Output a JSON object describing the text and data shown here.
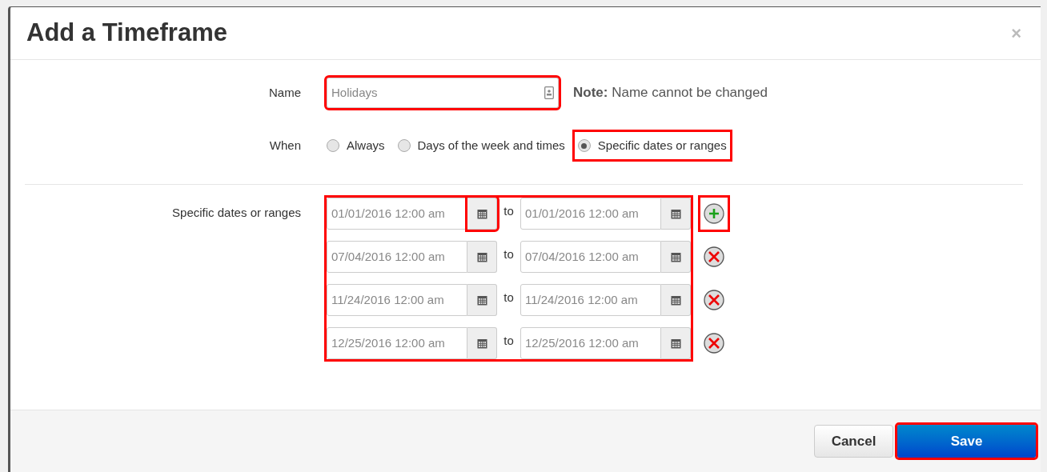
{
  "dialog": {
    "title": "Add a Timeframe",
    "close": "×"
  },
  "name_field": {
    "label": "Name",
    "value": "Holidays",
    "highlighted": true,
    "note_bold": "Note:",
    "note": "Name cannot be changed"
  },
  "when": {
    "label": "When",
    "options": [
      {
        "label": "Always",
        "selected": false,
        "highlighted": false
      },
      {
        "label": "Days of the week and times",
        "selected": false,
        "highlighted": false
      },
      {
        "label": "Specific dates or ranges",
        "selected": true,
        "highlighted": true
      }
    ]
  },
  "ranges": {
    "label": "Specific dates or ranges",
    "highlighted": true,
    "rows": [
      {
        "from": "01/01/2016 12:00 am",
        "separator": "to",
        "to": "01/01/2016 12:00 am",
        "kind": "add",
        "from_button_highlighted": true,
        "action_highlighted": true
      },
      {
        "from": "07/04/2016 12:00 am",
        "separator": "to",
        "to": "07/04/2016 12:00 am",
        "kind": "remove",
        "from_button_highlighted": false,
        "action_highlighted": false
      },
      {
        "from": "11/24/2016 12:00 am",
        "separator": "to",
        "to": "11/24/2016 12:00 am",
        "kind": "remove",
        "from_button_highlighted": false,
        "action_highlighted": false
      },
      {
        "from": "12/25/2016 12:00 am",
        "separator": "to",
        "to": "12/25/2016 12:00 am",
        "kind": "remove",
        "from_button_highlighted": false,
        "action_highlighted": false
      }
    ]
  },
  "footer": {
    "cancel": {
      "label": "Cancel",
      "highlighted": false
    },
    "save": {
      "label": "Save",
      "highlighted": true
    }
  }
}
